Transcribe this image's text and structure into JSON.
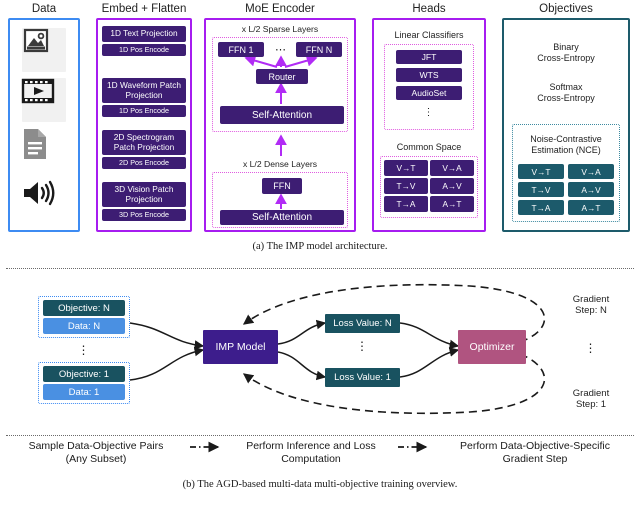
{
  "figure": {
    "caption_a": "(a) The IMP model architecture.",
    "caption_b": "(b) The AGD-based multi-data multi-objective training overview."
  },
  "panel_a": {
    "columns": [
      {
        "title": "Data",
        "accent": "#3d8bf2"
      },
      {
        "title": "Embed + Flatten",
        "accent": "#a61cf0"
      },
      {
        "title": "MoE Encoder",
        "accent": "#a61cf0"
      },
      {
        "title": "Heads",
        "accent": "#a61cf0"
      },
      {
        "title": "Objectives",
        "accent": "#1d5b6b"
      }
    ],
    "data": {
      "icons": [
        "image-icon",
        "video-icon",
        "document-icon",
        "audio-icon"
      ]
    },
    "embed": {
      "blocks": [
        {
          "main": "1D Text Projection",
          "pos": "1D Pos Encode"
        },
        {
          "main": "1D Waveform Patch Projection",
          "pos": "1D Pos Encode"
        },
        {
          "main": "2D Spectrogram Patch Projection",
          "pos": "2D Pos Encode"
        },
        {
          "main": "3D Vision Patch Projection",
          "pos": "3D Pos Encode"
        }
      ]
    },
    "moe": {
      "sparse_label": "x L/2 Sparse Layers",
      "dense_label": "x L/2 Dense Layers",
      "ffn_first": "FFN 1",
      "ffn_last": "FFN N",
      "ffn_ellipsis": "⋯",
      "router": "Router",
      "self_attention_sparse": "Self-Attention",
      "ffn_dense": "FFN",
      "self_attention_dense": "Self-Attention"
    },
    "heads": {
      "classifiers_title": "Linear Classifiers",
      "classifiers": [
        "JFT",
        "WTS",
        "AudioSet"
      ],
      "classifiers_ellipsis": "⋮",
      "common_space_title": "Common Space",
      "common_space": [
        "V→T",
        "V→A",
        "T→V",
        "A→V",
        "T→A",
        "A→T"
      ]
    },
    "objectives": {
      "binary": "Binary\nCross-Entropy",
      "binary_line1": "Binary",
      "binary_line2": "Cross-Entropy",
      "softmax_line1": "Softmax",
      "softmax_line2": "Cross-Entropy",
      "nce_line1": "Noise-Contrastive",
      "nce_line2": "Estimation (NCE)",
      "nce_pairs": [
        "V→T",
        "V→A",
        "T→V",
        "A→V",
        "T→A",
        "A→T"
      ]
    }
  },
  "panel_b": {
    "pairs": [
      {
        "objective": "Objective: N",
        "data": "Data: N"
      },
      {
        "objective": "Objective: 1",
        "data": "Data: 1"
      }
    ],
    "pairs_ellipsis": "⋮",
    "model": "IMP Model",
    "losses": [
      "Loss Value: N",
      "Loss Value: 1"
    ],
    "losses_ellipsis": "⋮",
    "optimizer": "Optimizer",
    "grad_top_line1": "Gradient",
    "grad_top_line2": "Step: N",
    "grad_bottom_line1": "Gradient",
    "grad_bottom_line2": "Step: 1",
    "grad_ellipsis": "⋮",
    "legend": [
      {
        "line1": "Sample Data-Objective Pairs",
        "line2": "(Any Subset)"
      },
      {
        "line1": "Perform Inference and Loss",
        "line2": "Computation"
      },
      {
        "line1": "Perform Data-Objective-Specific",
        "line2": "Gradient Step"
      }
    ]
  }
}
